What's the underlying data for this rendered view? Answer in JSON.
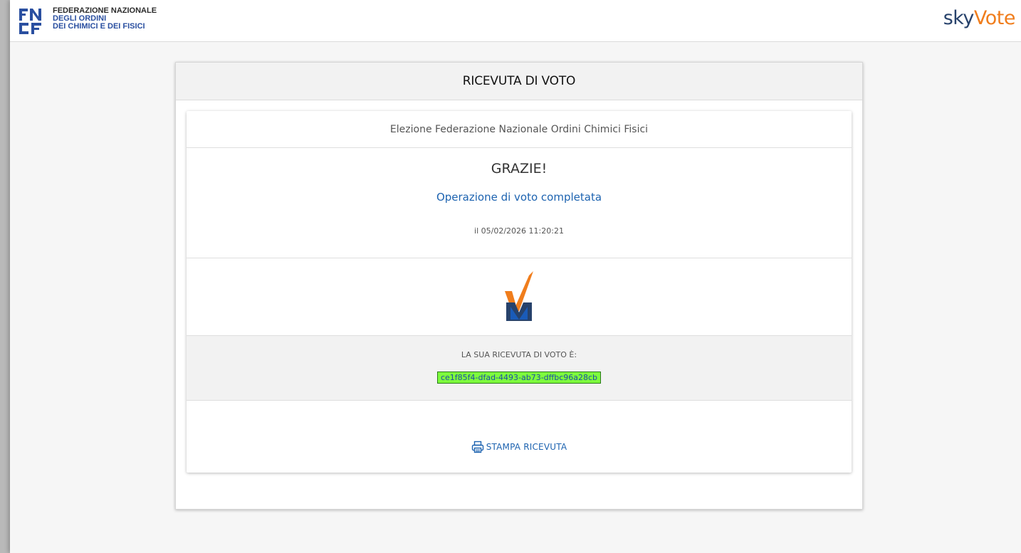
{
  "header": {
    "org_logo_lines": [
      "FEDERAZIONE NAZIONALE",
      "DEGLI ORDINI",
      "DEI CHIMICI E DEI FISICI"
    ],
    "brand_logo": {
      "part1": "sky",
      "part2": "V",
      "part3": "ote"
    }
  },
  "panel": {
    "title": "RICEVUTA DI VOTO"
  },
  "receipt": {
    "election_name": "Elezione Federazione Nazionale Ordini Chimici Fisici",
    "thanks": "GRAZIE!",
    "status": "Operazione di voto completata",
    "timestamp": "il 05/02/2026 11:20:21",
    "receipt_label": "LA SUA RICEVUTA DI VOTO È:",
    "receipt_code": "ce1f85f4-dfad-4493-ab73-dffbc96a28cb",
    "print_label": "STAMPA RICEVUTA"
  },
  "icons": {
    "vote_logo": "check-v-icon",
    "print": "printer-icon"
  },
  "colors": {
    "accent_blue": "#1d63b0",
    "brand_orange": "#f07d1c",
    "brand_navy": "#27426b",
    "receipt_highlight": "#7dfc3c"
  }
}
